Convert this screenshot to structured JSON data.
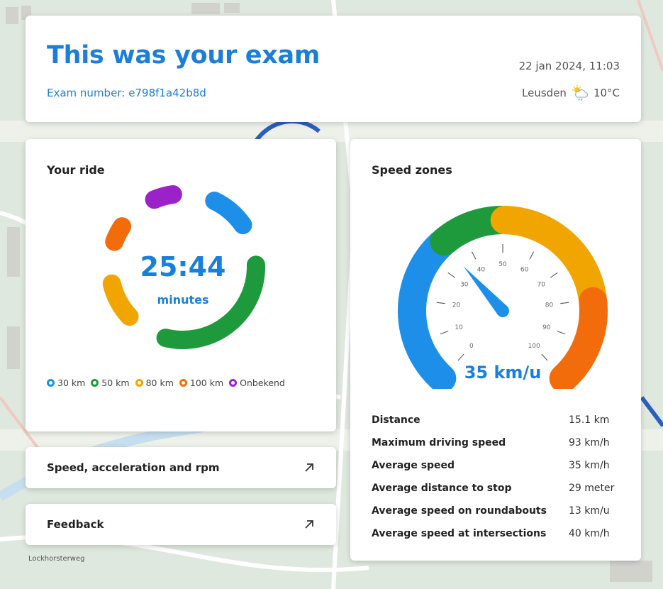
{
  "header": {
    "title": "This was your exam",
    "exam_number_label": "Exam number:",
    "exam_number": "e798f1a42b8d",
    "datetime": "22 jan 2024, 11:03",
    "location": "Leusden",
    "weather_icon": "sun-behind-rain-cloud-icon",
    "temperature": "10°C"
  },
  "map": {
    "street_label": "Lockhorsterweg"
  },
  "ride": {
    "title": "Your ride",
    "duration": "25:44",
    "duration_unit": "minutes",
    "segments": [
      {
        "zone": "30 km",
        "color": "#1e8fe8",
        "share": 0.135
      },
      {
        "zone": "50 km",
        "color": "#1e9a3c",
        "share": 0.345
      },
      {
        "zone": "80 km",
        "color": "#f0a500",
        "share": 0.135
      },
      {
        "zone": "100 km",
        "color": "#f26c0c",
        "share": 0.09
      },
      {
        "zone": "Onbekend",
        "color": "#9b22c9",
        "share": 0.095
      }
    ],
    "legend": [
      {
        "label": "30 km",
        "color": "#1e8fe8"
      },
      {
        "label": "50 km",
        "color": "#1e9a3c"
      },
      {
        "label": "80 km",
        "color": "#f0a500"
      },
      {
        "label": "100 km",
        "color": "#f26c0c"
      },
      {
        "label": "Onbekend",
        "color": "#9b22c9"
      }
    ]
  },
  "links": {
    "speed": "Speed, acceleration and rpm",
    "feedback": "Feedback"
  },
  "zones": {
    "title": "Speed zones",
    "speed_value": 35,
    "speed_label": "35 km/u",
    "dial": {
      "min": 0,
      "max": 100,
      "step": 10,
      "ticks": [
        "0",
        "10",
        "20",
        "30",
        "40",
        "50",
        "60",
        "70",
        "80",
        "90",
        "100"
      ]
    },
    "bands": [
      {
        "from": 0,
        "to": 35,
        "color": "#1e8fe8"
      },
      {
        "from": 35,
        "to": 50,
        "color": "#1e9a3c"
      },
      {
        "from": 50,
        "to": 80,
        "color": "#f0a500"
      },
      {
        "from": 80,
        "to": 100,
        "color": "#f26c0c"
      }
    ],
    "stats": [
      {
        "label": "Distance",
        "value": "15.1 km"
      },
      {
        "label": "Maximum driving speed",
        "value": "93 km/h"
      },
      {
        "label": "Average speed",
        "value": "35 km/h"
      },
      {
        "label": "Average distance to stop",
        "value": "29 meter"
      },
      {
        "label": "Average speed on roundabouts",
        "value": "13 km/u"
      },
      {
        "label": "Average speed at intersections",
        "value": "40 km/h"
      }
    ]
  },
  "colors": {
    "accent": "#1a7fd9",
    "needle": "#1e8fe8"
  }
}
